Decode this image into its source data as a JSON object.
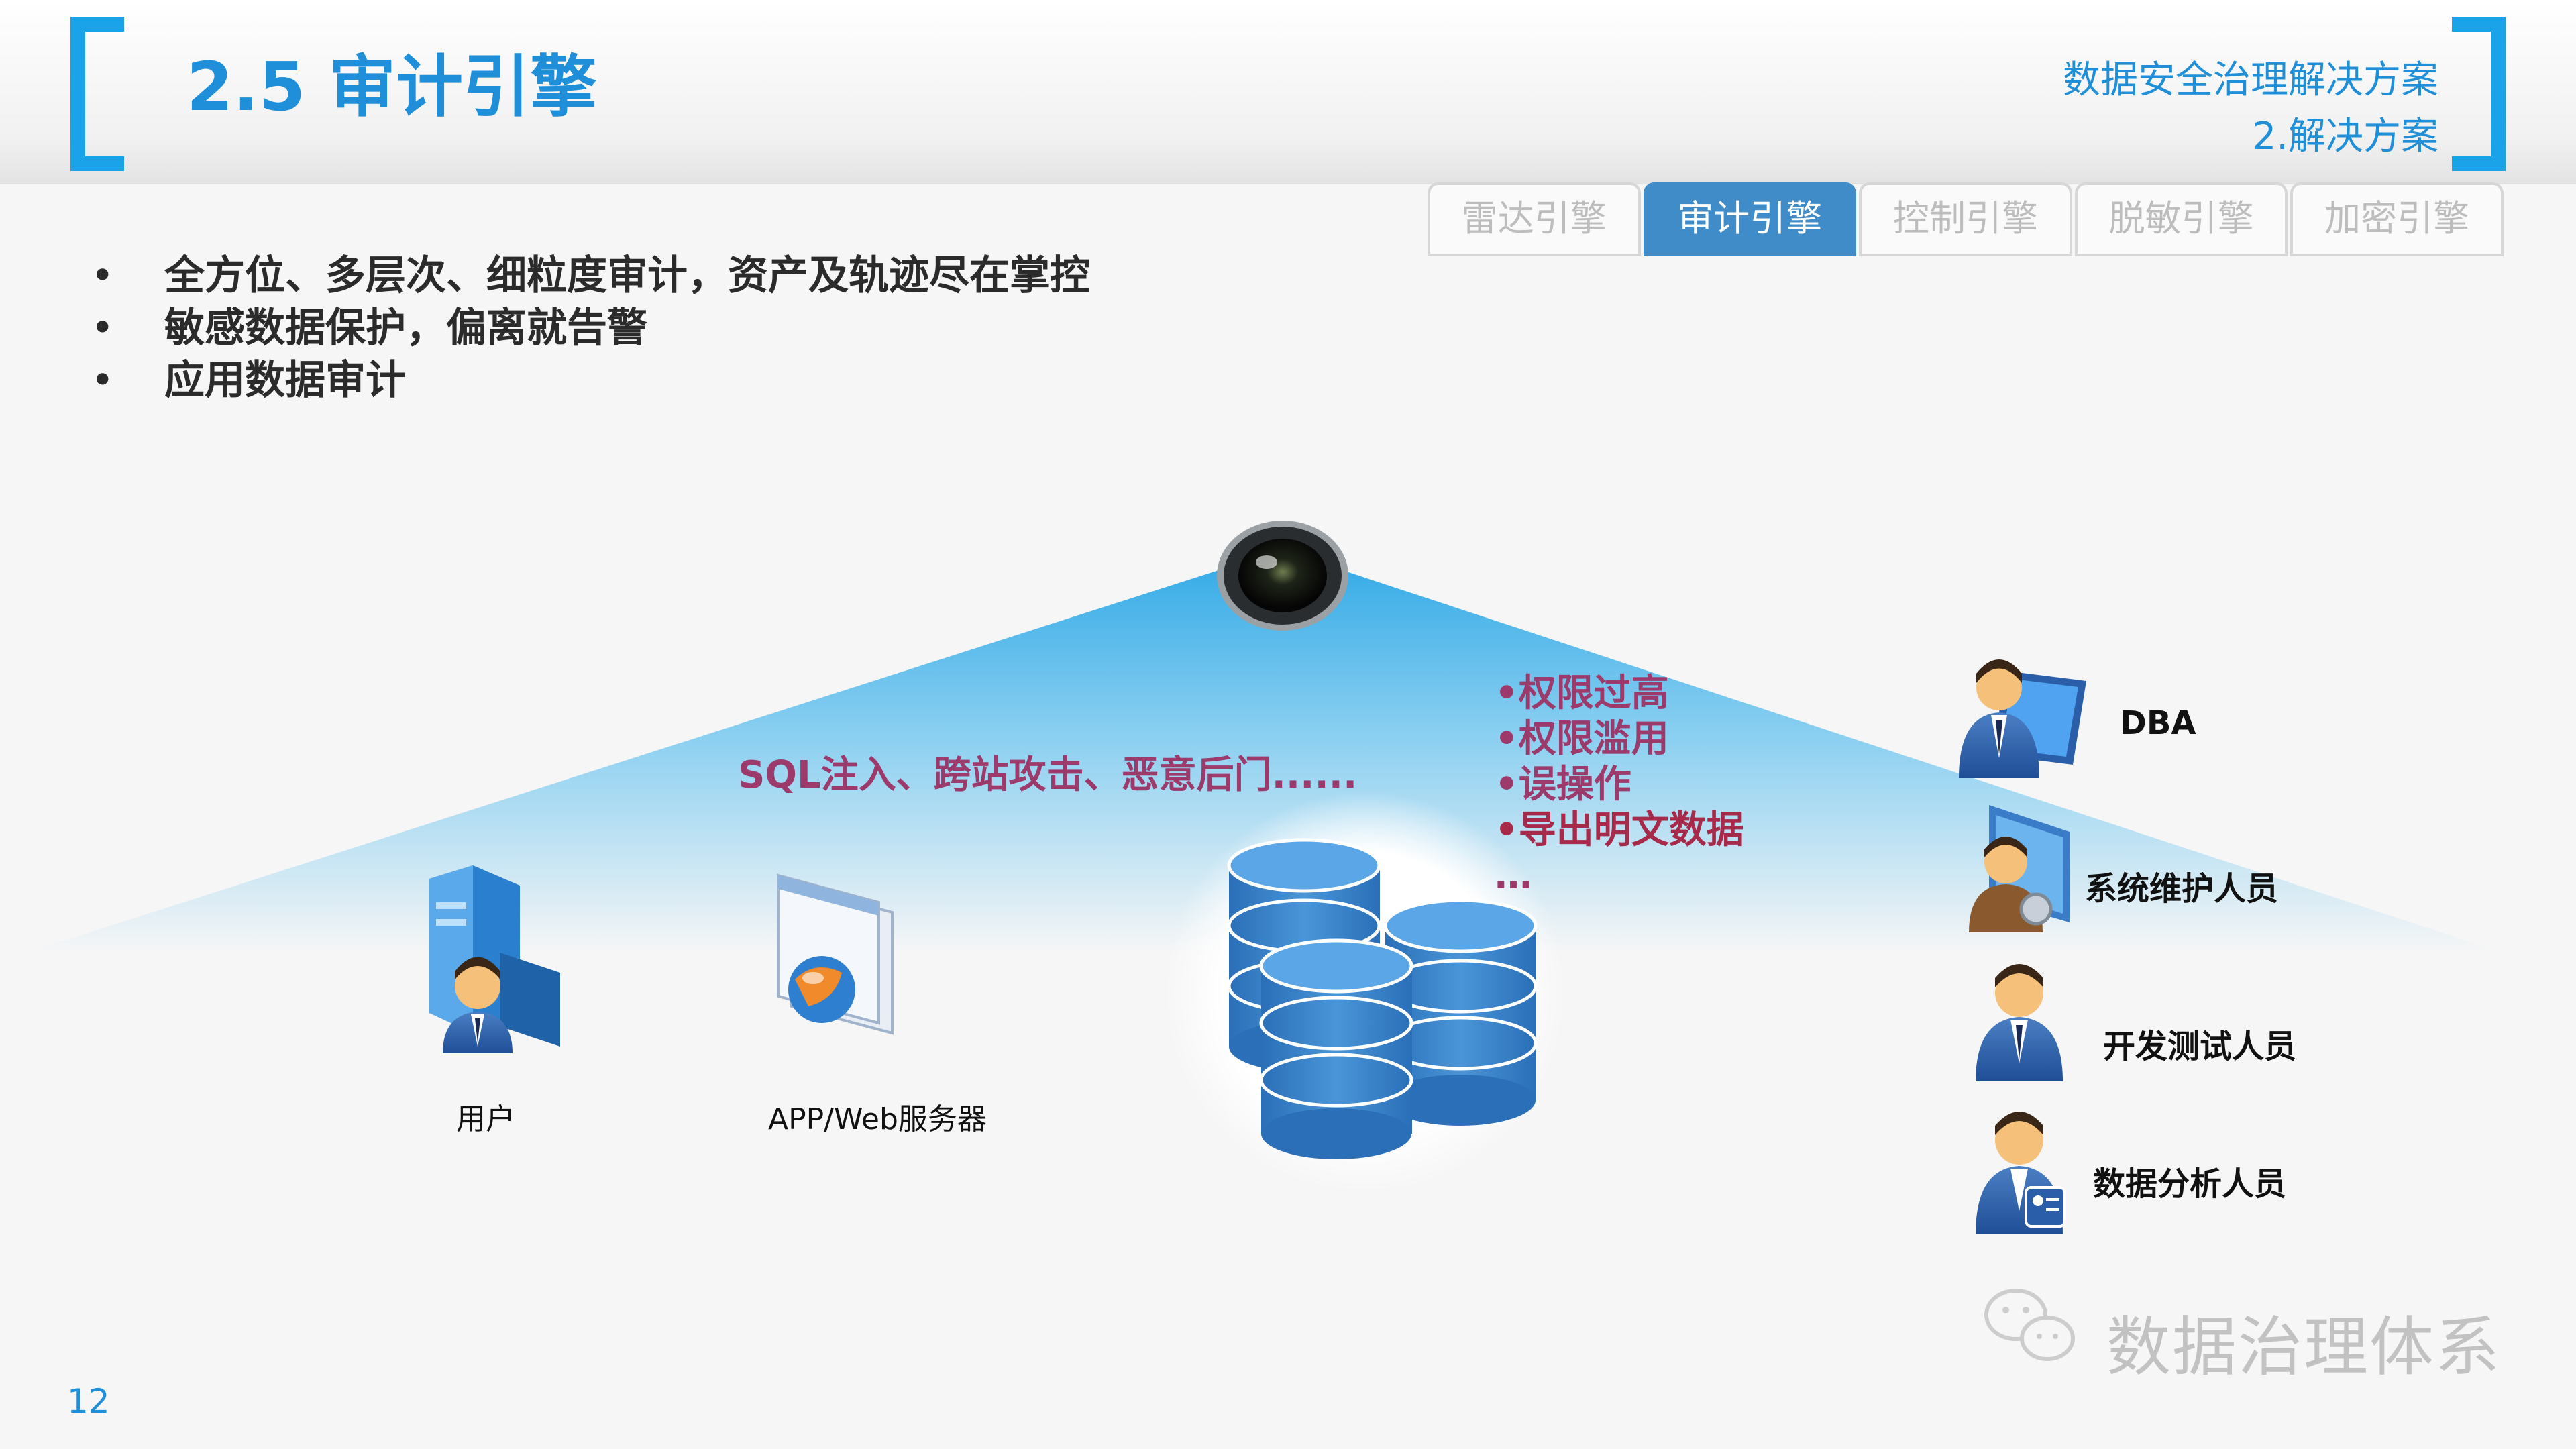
{
  "header": {
    "title": "2.5 审计引擎",
    "subtitle_line1": "数据安全治理解决方案",
    "subtitle_line2": "2.解决方案"
  },
  "tabs": [
    {
      "label": "雷达引擎",
      "active": false
    },
    {
      "label": "审计引擎",
      "active": true
    },
    {
      "label": "控制引擎",
      "active": false
    },
    {
      "label": "脱敏引擎",
      "active": false
    },
    {
      "label": "加密引擎",
      "active": false
    }
  ],
  "bullet_glyph": "•",
  "bullets": [
    "全方位、多层次、细粒度审计，资产及轨迹尽在掌控",
    "敏感数据保护，偏离就告警",
    "应用数据审计"
  ],
  "diagram": {
    "user_label": "用户",
    "server_label": "APP/Web服务器",
    "attack_text": "SQL注入、跨站攻击、恶意后门......",
    "risks": [
      "•权限过高",
      "•权限滥用",
      "•误操作",
      "•导出明文数据",
      "…"
    ],
    "roles": [
      "DBA",
      "系统维护人员",
      "开发测试人员",
      "数据分析人员"
    ]
  },
  "colors": {
    "accent": "#1aa3e8",
    "title": "#1e8fd8",
    "tab_active": "#3f8cc8",
    "risk_text": "#9b3a6b",
    "db_blue": "#3f86cc"
  },
  "footer": {
    "page_number": "12",
    "watermark": "数据治理体系"
  }
}
